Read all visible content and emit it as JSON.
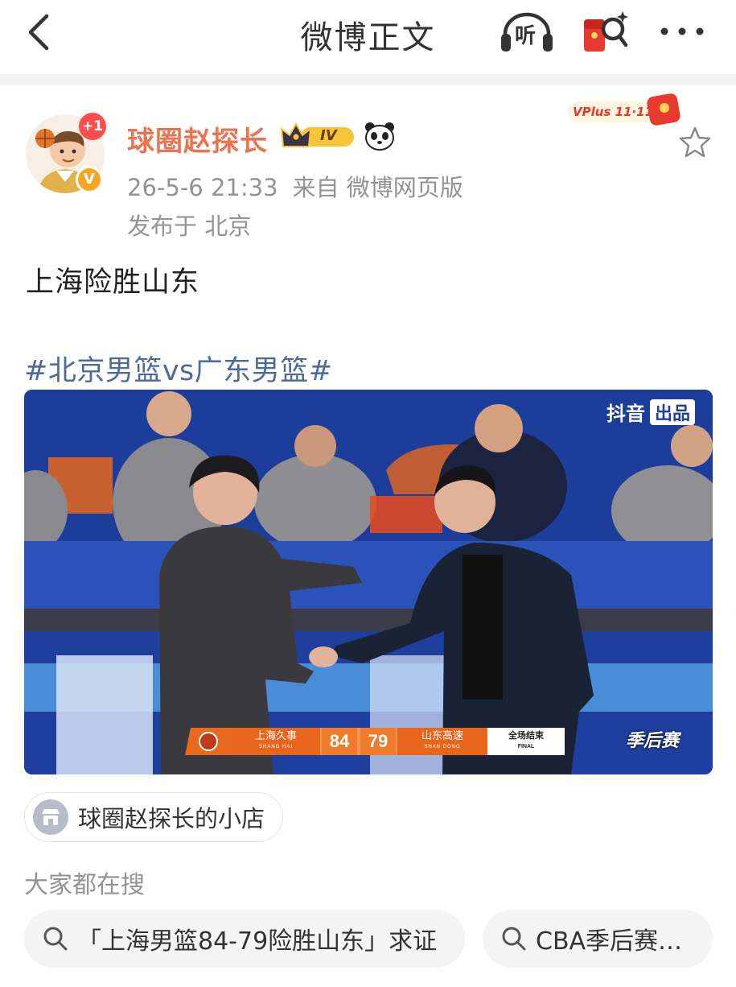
{
  "nav": {
    "title": "微博正文",
    "listen_label": "听",
    "icons": [
      "back-arrow-icon",
      "headphones-icon",
      "red-packet-icon",
      "more-icon"
    ]
  },
  "author": {
    "name": "球圈赵探长",
    "notification_badge": "+1",
    "verified_mark": "V",
    "vip_level": "IV",
    "timestamp": "26-5-6 21:33",
    "source": "来自 微博网页版",
    "location": "发布于 北京",
    "vplus_label": "VPlus 11·11"
  },
  "post": {
    "text": "上海险胜山东",
    "topic": "#北京男篮vs广东男篮#"
  },
  "image": {
    "watermark_app": "抖音",
    "watermark_tag": "出品",
    "scoreboard": {
      "home_team": "上海久事",
      "home_team_en": "SHANG HAI",
      "home_score": "84",
      "away_score": "79",
      "away_team": "山东高速",
      "away_team_en": "SHAN DONG",
      "status": "全场结束",
      "status_en": "FINAL"
    },
    "event_logo": "季后赛"
  },
  "store": {
    "label": "球圈赵探长的小店"
  },
  "trending": {
    "title": "大家都在搜",
    "items": [
      "「上海男篮84-79险胜山东」求证",
      "CBA季后赛…"
    ]
  },
  "colors": {
    "username": "#eb7350",
    "topic_link": "#4d6a99",
    "meta_text": "#939393",
    "scoreboard_orange": "#e8661c"
  }
}
